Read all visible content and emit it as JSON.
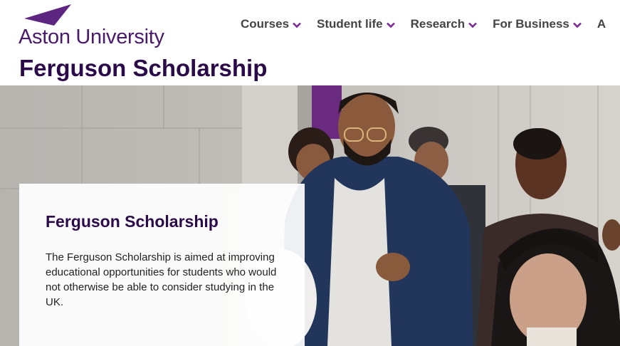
{
  "header": {
    "logo_text": "Aston University",
    "nav": [
      {
        "label": "Courses"
      },
      {
        "label": "Student life"
      },
      {
        "label": "Research"
      },
      {
        "label": "For Business"
      },
      {
        "label": "A"
      }
    ]
  },
  "page": {
    "title": "Ferguson Scholarship"
  },
  "card": {
    "title": "Ferguson Scholarship",
    "body": "The Ferguson Scholarship is aimed at improving educational opportunities for students who would not otherwise be able to consider studying in the UK."
  },
  "colors": {
    "brand_purple": "#5c2580",
    "title_purple": "#2b0a4a",
    "nav_text": "#444444"
  }
}
